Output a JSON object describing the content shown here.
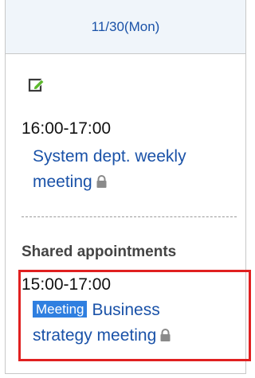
{
  "header": {
    "date": "11/30(Mon)"
  },
  "events": [
    {
      "time": "16:00-17:00",
      "title_line1": "System dept. weekly",
      "title_line2": "meeting",
      "private": true
    }
  ],
  "shared": {
    "label": "Shared appointments",
    "events": [
      {
        "time": "15:00-17:00",
        "badge": "Meeting",
        "title_line1": "Business",
        "title_line2": "strategy meeting",
        "private": true
      }
    ]
  },
  "colors": {
    "link": "#1a52a8",
    "badge": "#2f7fe0",
    "highlight": "#e02020",
    "edit_icon": "#3a3a3a",
    "edit_icon_accent": "#5cb82c"
  },
  "icons": {
    "edit": "edit-schedule-icon",
    "lock": "lock-icon"
  }
}
